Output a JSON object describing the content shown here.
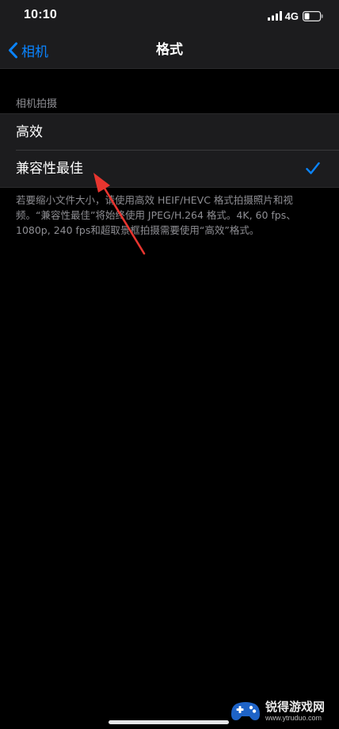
{
  "status_bar": {
    "time": "10:10",
    "network": "4G",
    "signal_icon": "cellular-signal-icon",
    "battery_icon": "battery-low-icon"
  },
  "nav": {
    "back_label": "相机",
    "back_icon": "chevron-left-icon",
    "title": "格式"
  },
  "section": {
    "header": "相机拍摄",
    "options": [
      {
        "label": "高效",
        "selected": false
      },
      {
        "label": "兼容性最佳",
        "selected": true
      }
    ],
    "check_icon": "checkmark-icon"
  },
  "footer_note": "若要缩小文件大小，请使用高效 HEIF/HEVC 格式拍摄照片和视频。“兼容性最佳”将始终使用 JPEG/H.264 格式。4K, 60 fps、1080p, 240 fps和超取景框拍摄需要使用“高效”格式。",
  "annotation": {
    "icon": "red-arrow-annotation",
    "color": "#e8352f"
  },
  "watermark": {
    "name": "锐得游戏网",
    "url": "www.ytruduo.com"
  },
  "colors": {
    "accent": "#0a84ff",
    "background": "#000000",
    "grouped_cell": "#1c1c1e",
    "secondary_text": "#8e8e93"
  }
}
